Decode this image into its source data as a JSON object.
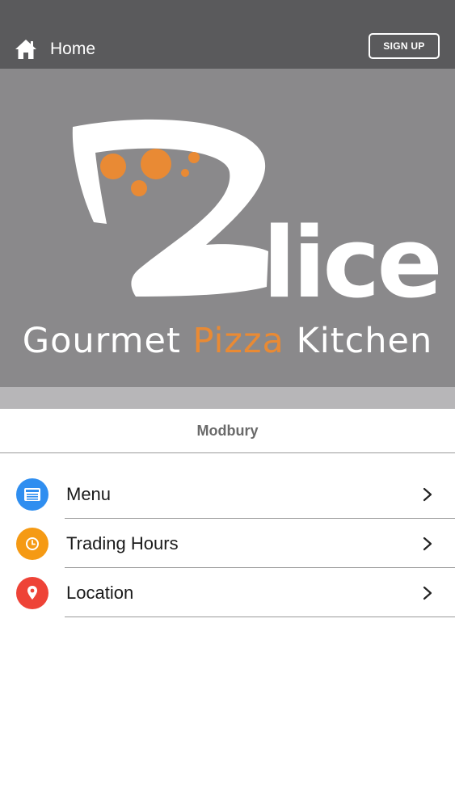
{
  "header": {
    "home_icon": "home-icon",
    "home_label": "Home",
    "signup_label": "SIGN UP"
  },
  "hero": {
    "logo_text": "Zlice",
    "tagline_part1": "Gourmet ",
    "tagline_accent": "Pizza",
    "tagline_part2": " Kitchen",
    "colors": {
      "background": "#8a898b",
      "accent": "#e98a34"
    }
  },
  "location": {
    "name": "Modbury"
  },
  "menu": {
    "items": [
      {
        "label": "Menu",
        "icon": "menu-list-icon",
        "color": "#2f8ef0"
      },
      {
        "label": "Trading Hours",
        "icon": "clock-icon",
        "color": "#f59a14"
      },
      {
        "label": "Location",
        "icon": "map-pin-icon",
        "color": "#ee4337"
      }
    ]
  }
}
